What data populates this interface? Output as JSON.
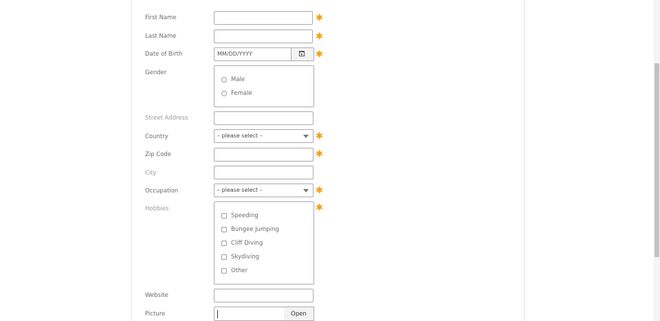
{
  "form": {
    "first_name_label": "First Name",
    "last_name_label": "Last Name",
    "dob_label": "Date of Birth",
    "dob_placeholder": "MM/DD/YYYY",
    "gender_label": "Gender",
    "gender_options": [
      "Male",
      "Female"
    ],
    "street_label": "Street Address",
    "country_label": "Country",
    "country_value": "– please select –",
    "zip_label": "Zip Code",
    "city_label": "City",
    "occupation_label": "Occupation",
    "occupation_value": "– please select –",
    "hobbies_label": "Hobbies",
    "hobbies_options": [
      "Speeding",
      "Bungee Jumping",
      "Cliff Diving",
      "Skydiving",
      "Other"
    ],
    "website_label": "Website",
    "picture_label": "Picture",
    "open_button": "Open",
    "required_marker": "✱"
  },
  "colors": {
    "required": "#f39c12",
    "border": "#aaaaaa"
  },
  "icons": {
    "date_picker": "calendar-icon",
    "select_arrow": "chevron-down-icon"
  }
}
